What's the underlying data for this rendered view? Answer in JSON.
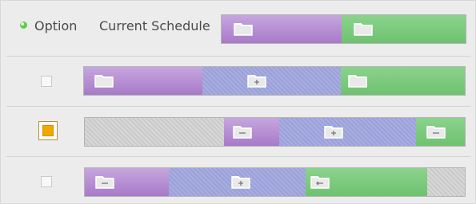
{
  "header": {
    "option_label": "Option",
    "current_schedule_label": "Current Schedule"
  },
  "options": [
    {
      "checked": false
    },
    {
      "checked": true
    },
    {
      "checked": false
    }
  ],
  "icons": {
    "folder": "folder-icon",
    "folder_plus": "folder-plus-icon",
    "folder_minus": "folder-minus-icon",
    "folder_arrow": "folder-arrow-icon"
  },
  "colors": {
    "purple": "#b58fd4",
    "blue_hatch": "#a7acdf",
    "green": "#79c87b",
    "gray_hatch": "#cfcfcf",
    "selected_orange": "#f0a800"
  }
}
